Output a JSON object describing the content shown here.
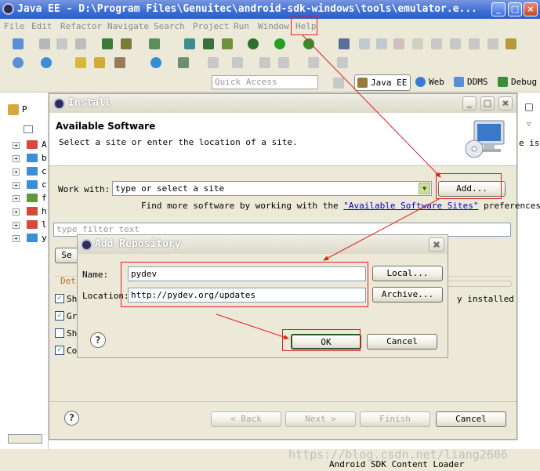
{
  "window": {
    "title": "Java EE - D:\\Program Files\\Genuitec\\android-sdk-windows\\tools\\emulator.e..."
  },
  "menu": {
    "items": [
      "File",
      "Edit",
      "Refactor",
      "Navigate",
      "Search",
      "Project",
      "Run",
      "Window",
      "Help"
    ]
  },
  "toolbar": {
    "quick_access_placeholder": "Quick Access",
    "perspectives": [
      "Java EE",
      "Web",
      "DDMS",
      "Debug"
    ]
  },
  "left_panel": {
    "tab_label": "P",
    "tree_items": [
      "A",
      "b",
      "c",
      "c",
      "f",
      "h",
      "l",
      "y"
    ]
  },
  "right_strip": {
    "text": "e is"
  },
  "install_dialog": {
    "title": "Install",
    "heading": "Available Software",
    "subtitle": "Select a site or enter the location of a site.",
    "work_with_label": "Work with:",
    "work_with_value": "type or select a site",
    "add_button": "Add...",
    "find_more_prefix": "Find more software by working with the ",
    "find_more_link": "\"Available Software Sites\"",
    "find_more_suffix": " preferences.",
    "filter_placeholder": "type filter text",
    "select_all_partial": "Se",
    "details_partial": "Det",
    "checkboxes": [
      {
        "label": "Sh",
        "checked": true
      },
      {
        "label": "Gr",
        "checked": true
      },
      {
        "label": "Sh",
        "checked": false
      },
      {
        "label": "Co",
        "checked": true
      }
    ],
    "installed_text": "y installed",
    "back_button": "< Back",
    "next_button": "Next >",
    "finish_button": "Finish",
    "cancel_button": "Cancel"
  },
  "repo_dialog": {
    "title": "Add Repository",
    "name_label": "Name:",
    "name_value": "pydev",
    "location_label": "Location:",
    "location_value": "http://pydev.org/updates",
    "local_button": "Local...",
    "archive_button": "Archive...",
    "ok_button": "OK",
    "cancel_button": "Cancel"
  },
  "watermark": "https://blog.csdn.net/liang2606",
  "status_bar": {
    "text": "Android SDK Content Loader"
  },
  "colors": {
    "annotation": "#e02020",
    "link": "#0000cc",
    "dialog_bg": "#ece9d8",
    "titlebar_blue": "#3b6dd6"
  }
}
